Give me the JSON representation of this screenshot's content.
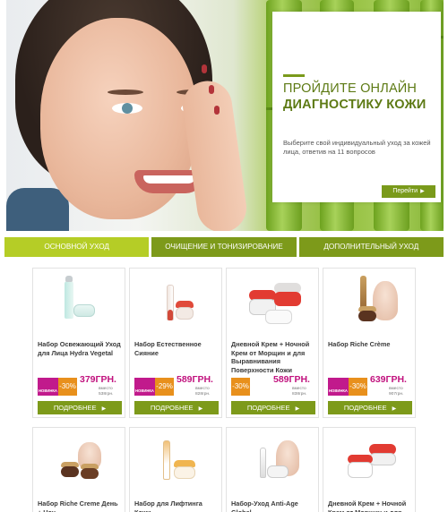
{
  "hero": {
    "title_line1": "Пройдите онлайн",
    "title_line2": "диагностику кожи",
    "text": "Выберите свой индивидуальный уход за кожей лица, ответив на 11 вопросов",
    "button": "Перейти"
  },
  "tabs": [
    {
      "label": "Основной уход",
      "active": true
    },
    {
      "label": "Очищение и тонизирование",
      "active": false
    },
    {
      "label": "Дополнительный уход",
      "active": false
    }
  ],
  "badges": {
    "new": "НОВИНКА",
    "was": "вместо",
    "more": "ПОДРОБНЕЕ"
  },
  "products": [
    {
      "name": "Набор Освежающий Уход для Лица Hydra Vegetal",
      "new": true,
      "discount": "-30%",
      "price": "379ГРН.",
      "old_price": "538грн."
    },
    {
      "name": "Набор Естественное Сияние",
      "new": true,
      "discount": "-29%",
      "price": "589ГРН.",
      "old_price": "828грн."
    },
    {
      "name": "Дневной Крем + Ночной Крем от Морщин и для Выравнивания Поверхности Кожи",
      "new": false,
      "discount": "-30%",
      "price": "589ГРН.",
      "old_price": "838грн."
    },
    {
      "name": "Набор Riche Crème",
      "new": true,
      "discount": "-30%",
      "price": "639ГРН.",
      "old_price": "907грн."
    },
    {
      "name": "Набор Riche Creme День + Ноч..."
    },
    {
      "name": "Набор для Лифтинга Кожи"
    },
    {
      "name": "Набор-Уход Anti-Age Global"
    },
    {
      "name": "Дневной Крем + Ночной Крем от Морщин и для"
    }
  ],
  "colors": {
    "green": "#7d9a1a",
    "tab_active": "#b5cd26",
    "magenta": "#c1127e",
    "orange": "#e8901c"
  }
}
